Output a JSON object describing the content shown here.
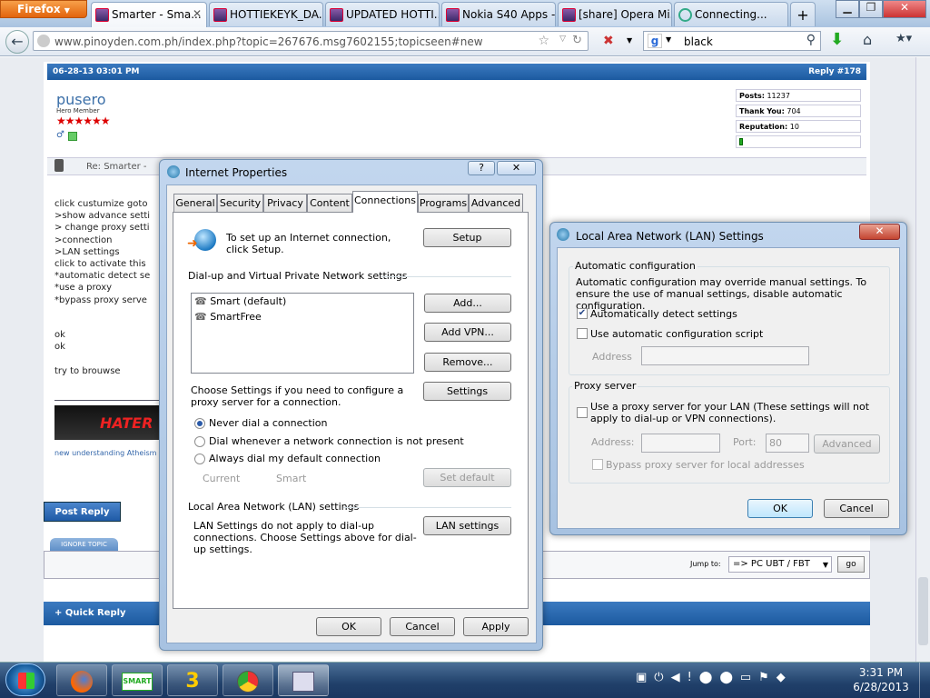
{
  "browser": {
    "menu_label": "Firefox",
    "tabs": [
      {
        "label": "Smarter - Sma...",
        "active": true
      },
      {
        "label": "HOTTIEKEYK_DA..."
      },
      {
        "label": "UPDATED HOTTI..."
      },
      {
        "label": "Nokia S40 Apps -..."
      },
      {
        "label": "[share] Opera Mi..."
      },
      {
        "label": "Connecting..."
      }
    ],
    "new_tab": "+",
    "url": "www.pinoyden.com.ph/index.php?topic=267676.msg7602155;topicseen#new",
    "search_value": "black"
  },
  "post": {
    "date": "06-28-13 03:01 PM",
    "reply_no": "Reply #178",
    "username": "pusero",
    "rank": "Hero Member",
    "stats": [
      {
        "label": "Posts:",
        "value": "11237"
      },
      {
        "label": "Thank You:",
        "value": "704"
      },
      {
        "label": "Reputation:",
        "value": "10"
      }
    ],
    "subject": "Re: Smarter -",
    "body_lines": [
      "click custumize goto",
      ">show advance setti",
      "> change proxy setti",
      ">connection",
      ">LAN settings",
      "click to activate this",
      "*automatic detect se",
      "*use a proxy",
      "*bypass proxy serve"
    ],
    "ok1": "ok",
    "ok2": "ok",
    "try_text": "try to brouwse",
    "sig_text": "HATER",
    "sig_sub": "new understanding Atheism",
    "post_reply": "Post Reply",
    "ignore_topic": "IGNORE TOPIC",
    "jump_label": "Jump to:",
    "jump_value": "=> PC UBT / FBT",
    "go": "go",
    "quick_reply": "Quick Reply"
  },
  "internet_properties": {
    "title": "Internet Properties",
    "help": "?",
    "close": "✕",
    "tabs": [
      "General",
      "Security",
      "Privacy",
      "Content",
      "Connections",
      "Programs",
      "Advanced"
    ],
    "active_tab": "Connections",
    "setup_text": "To set up an Internet connection, click Setup.",
    "setup_btn": "Setup",
    "dialup_header": "Dial-up and Virtual Private Network settings",
    "connections": [
      "Smart (default)",
      "SmartFree"
    ],
    "add_btn": "Add...",
    "addvpn_btn": "Add VPN...",
    "remove_btn": "Remove...",
    "choose_text": "Choose Settings if you need to configure a proxy server for a connection.",
    "settings_btn": "Settings",
    "radio_never": "Never dial a connection",
    "radio_whenever": "Dial whenever a network connection is not present",
    "radio_always": "Always dial my default connection",
    "current_label": "Current",
    "current_value": "Smart",
    "setdefault_btn": "Set default",
    "lan_header": "Local Area Network (LAN) settings",
    "lan_text": "LAN Settings do not apply to dial-up connections. Choose Settings above for dial-up settings.",
    "lan_btn": "LAN settings",
    "ok": "OK",
    "cancel": "Cancel",
    "apply": "Apply"
  },
  "lan_settings": {
    "title": "Local Area Network (LAN) Settings",
    "close": "✕",
    "auto_header": "Automatic configuration",
    "auto_desc": "Automatic configuration may override manual settings.  To ensure the use of manual settings, disable automatic configuration.",
    "auto_detect": "Automatically detect settings",
    "auto_detect_checked": true,
    "auto_script": "Use automatic configuration script",
    "address_label": "Address",
    "proxy_header": "Proxy server",
    "proxy_text": "Use a proxy server for your LAN (These settings will not apply to dial-up or VPN connections).",
    "proxy_address_label": "Address:",
    "port_label": "Port:",
    "port_value": "80",
    "advanced_btn": "Advanced",
    "bypass_text": "Bypass proxy server for local addresses",
    "ok": "OK",
    "cancel": "Cancel"
  },
  "taskbar": {
    "time": "3:31 PM",
    "date": "6/28/2013"
  }
}
